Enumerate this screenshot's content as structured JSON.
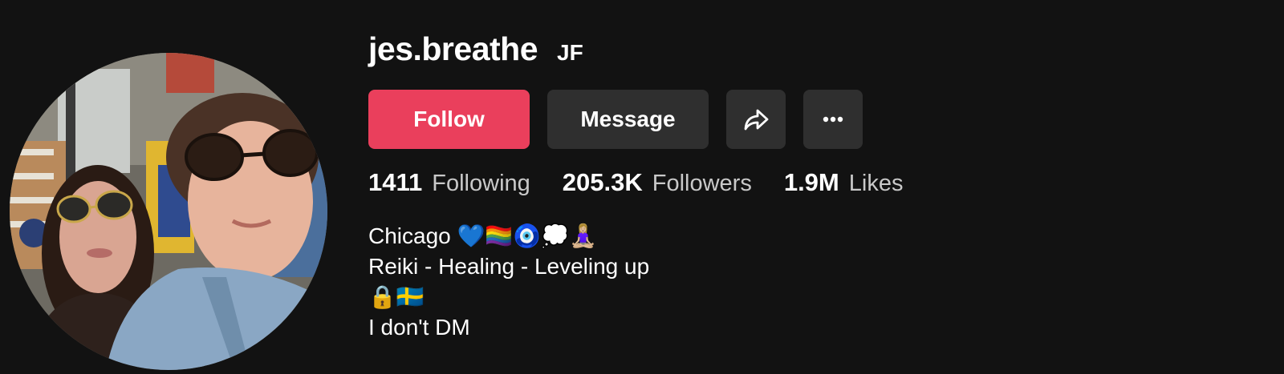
{
  "profile": {
    "username": "jes.breathe",
    "nickname": "JF"
  },
  "avatar": {
    "icon": "profile-photo"
  },
  "actions": {
    "follow_label": "Follow",
    "message_label": "Message",
    "share_icon": "share-arrow-icon",
    "more_icon": "more-dots-icon"
  },
  "stats": {
    "following": {
      "value": "1411",
      "label": "Following"
    },
    "followers": {
      "value": "205.3K",
      "label": "Followers"
    },
    "likes": {
      "value": "1.9M",
      "label": "Likes"
    }
  },
  "bio": {
    "lines": [
      "Chicago 💙🏳️‍🌈🧿💭🧘🏼‍♀️",
      "Reiki - Healing - Leveling up",
      "🔒🇸🇪",
      "I don't DM"
    ]
  },
  "colors": {
    "background": "#121212",
    "follow_button": "#ea3f5c",
    "secondary_button": "#2f2f2f",
    "muted_text": "#c9c9c9"
  }
}
